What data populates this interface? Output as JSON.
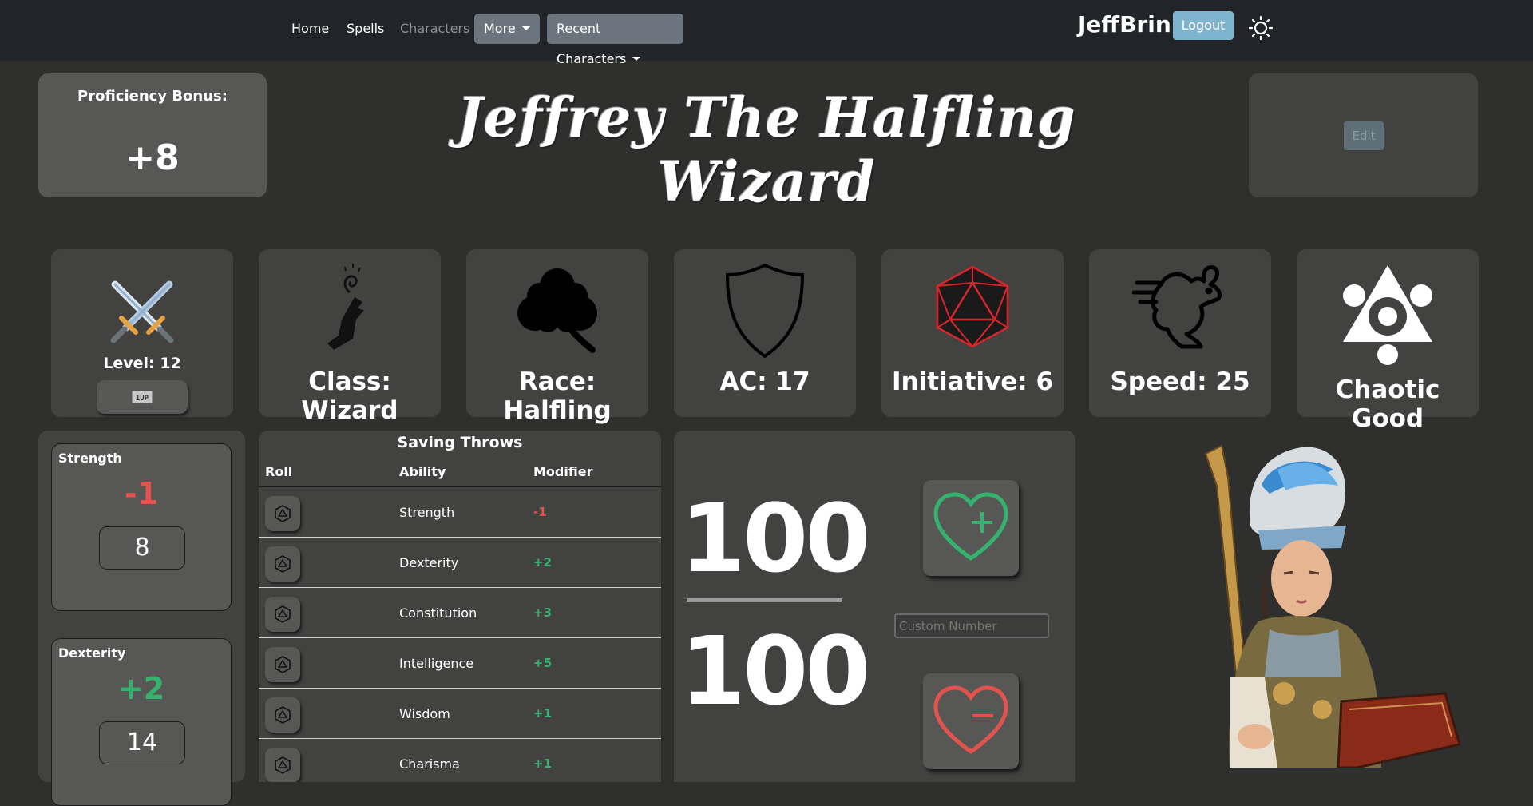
{
  "nav": {
    "home": "Home",
    "spells": "Spells",
    "characters": "Characters",
    "more": "More",
    "recent": "Recent Characters",
    "username": "JeffBrin",
    "logout": "Logout"
  },
  "header": {
    "proficiency_label": "Proficiency Bonus:",
    "proficiency_value": "+8",
    "character_name": "Jeffrey The Halfling Wizard",
    "edit": "Edit"
  },
  "stats": {
    "level": "Level: 12",
    "levelup_icon": "1UP",
    "class": "Class: Wizard",
    "race": "Race: Halfling",
    "ac": "AC: 17",
    "initiative": "Initiative: 6",
    "speed": "Speed: 25",
    "alignment": "Chaotic Good"
  },
  "abilities": [
    {
      "name": "Strength",
      "mod": "-1",
      "score": "8"
    },
    {
      "name": "Dexterity",
      "mod": "+2",
      "score": "14"
    }
  ],
  "saving_throws": {
    "title": "Saving Throws",
    "headers": [
      "Roll",
      "Ability",
      "Modifier"
    ],
    "rows": [
      {
        "ability": "Strength",
        "mod": "-1"
      },
      {
        "ability": "Dexterity",
        "mod": "+2"
      },
      {
        "ability": "Constitution",
        "mod": "+3"
      },
      {
        "ability": "Intelligence",
        "mod": "+5"
      },
      {
        "ability": "Wisdom",
        "mod": "+1"
      },
      {
        "ability": "Charisma",
        "mod": "+1"
      }
    ]
  },
  "hp": {
    "current": "100",
    "max": "100",
    "custom_placeholder": "Custom Number"
  },
  "colors": {
    "negative": "#e2534e",
    "positive": "#35b36e",
    "heal": "#35b36e",
    "damage": "#e2534e"
  }
}
